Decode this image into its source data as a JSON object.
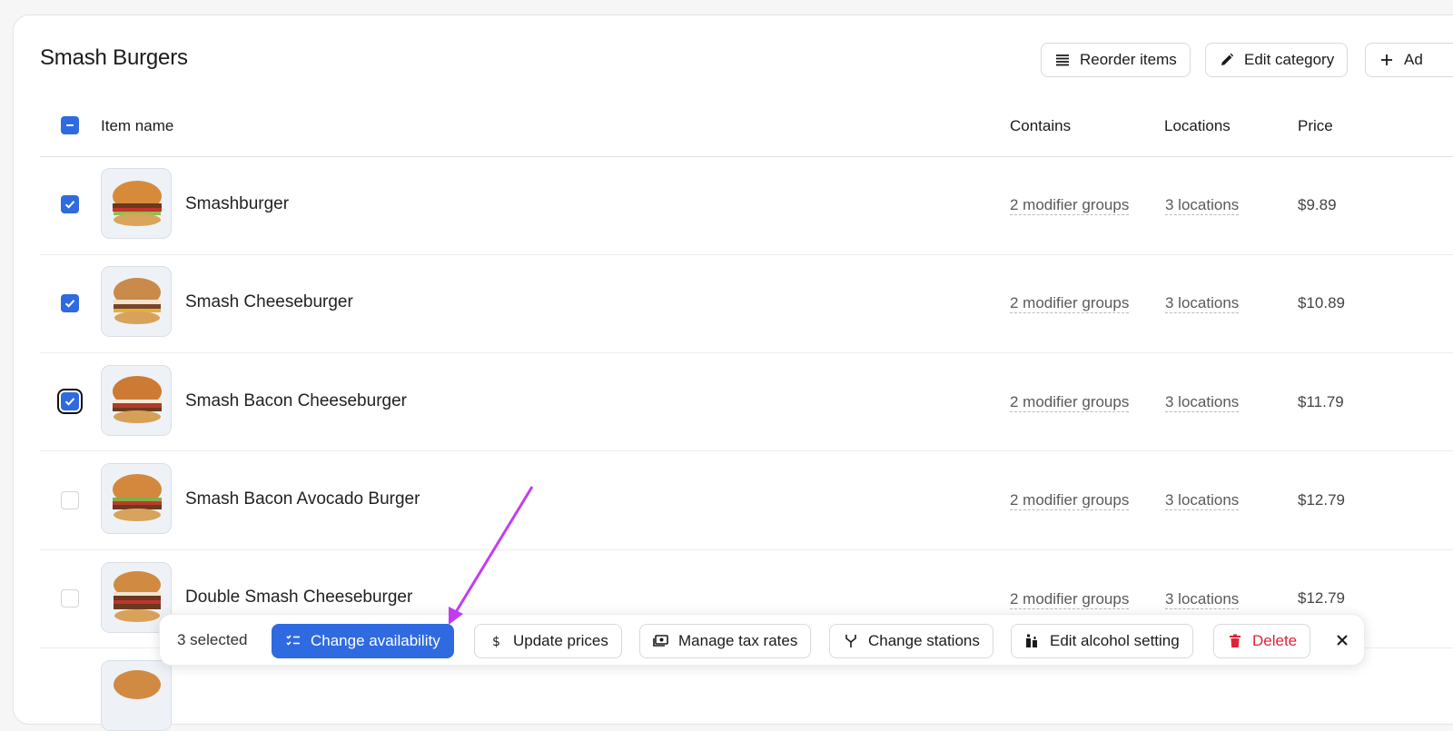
{
  "category": {
    "title": "Smash Burgers"
  },
  "header_actions": {
    "reorder_label": "Reorder items",
    "edit_label": "Edit category",
    "add_label": "Ad"
  },
  "table": {
    "headers": {
      "item_name": "Item name",
      "contains": "Contains",
      "locations": "Locations",
      "price": "Price"
    },
    "rows": [
      {
        "name": "Smashburger",
        "contains": "2 modifier groups",
        "locations": "3 locations",
        "price": "$9.89",
        "checked": true
      },
      {
        "name": "Smash Cheeseburger",
        "contains": "2 modifier groups",
        "locations": "3 locations",
        "price": "$10.89",
        "checked": true
      },
      {
        "name": "Smash Bacon Cheeseburger",
        "contains": "2 modifier groups",
        "locations": "3 locations",
        "price": "$11.79",
        "checked": true
      },
      {
        "name": "Smash Bacon Avocado Burger",
        "contains": "2 modifier groups",
        "locations": "3 locations",
        "price": "$12.79",
        "checked": false
      },
      {
        "name": "Double Smash Cheeseburger",
        "contains": "2 modifier groups",
        "locations": "3 locations",
        "price": "$12.79",
        "checked": false
      }
    ]
  },
  "bulk_toolbar": {
    "selected_text": "3 selected",
    "change_availability": "Change availability",
    "update_prices": "Update prices",
    "manage_tax_rates": "Manage tax rates",
    "change_stations": "Change stations",
    "edit_alcohol": "Edit alcohol setting",
    "delete": "Delete"
  },
  "colors": {
    "accent": "#2f6ae0",
    "danger": "#e0223a",
    "annotation_arrow": "#c13ef0"
  },
  "icons": [
    "list-icon",
    "pencil-icon",
    "plus-icon",
    "checklist-icon",
    "dollar-icon",
    "cash-icon",
    "fork-icon",
    "bottle-icon",
    "trash-icon",
    "close-icon",
    "check-icon",
    "minus-icon"
  ]
}
